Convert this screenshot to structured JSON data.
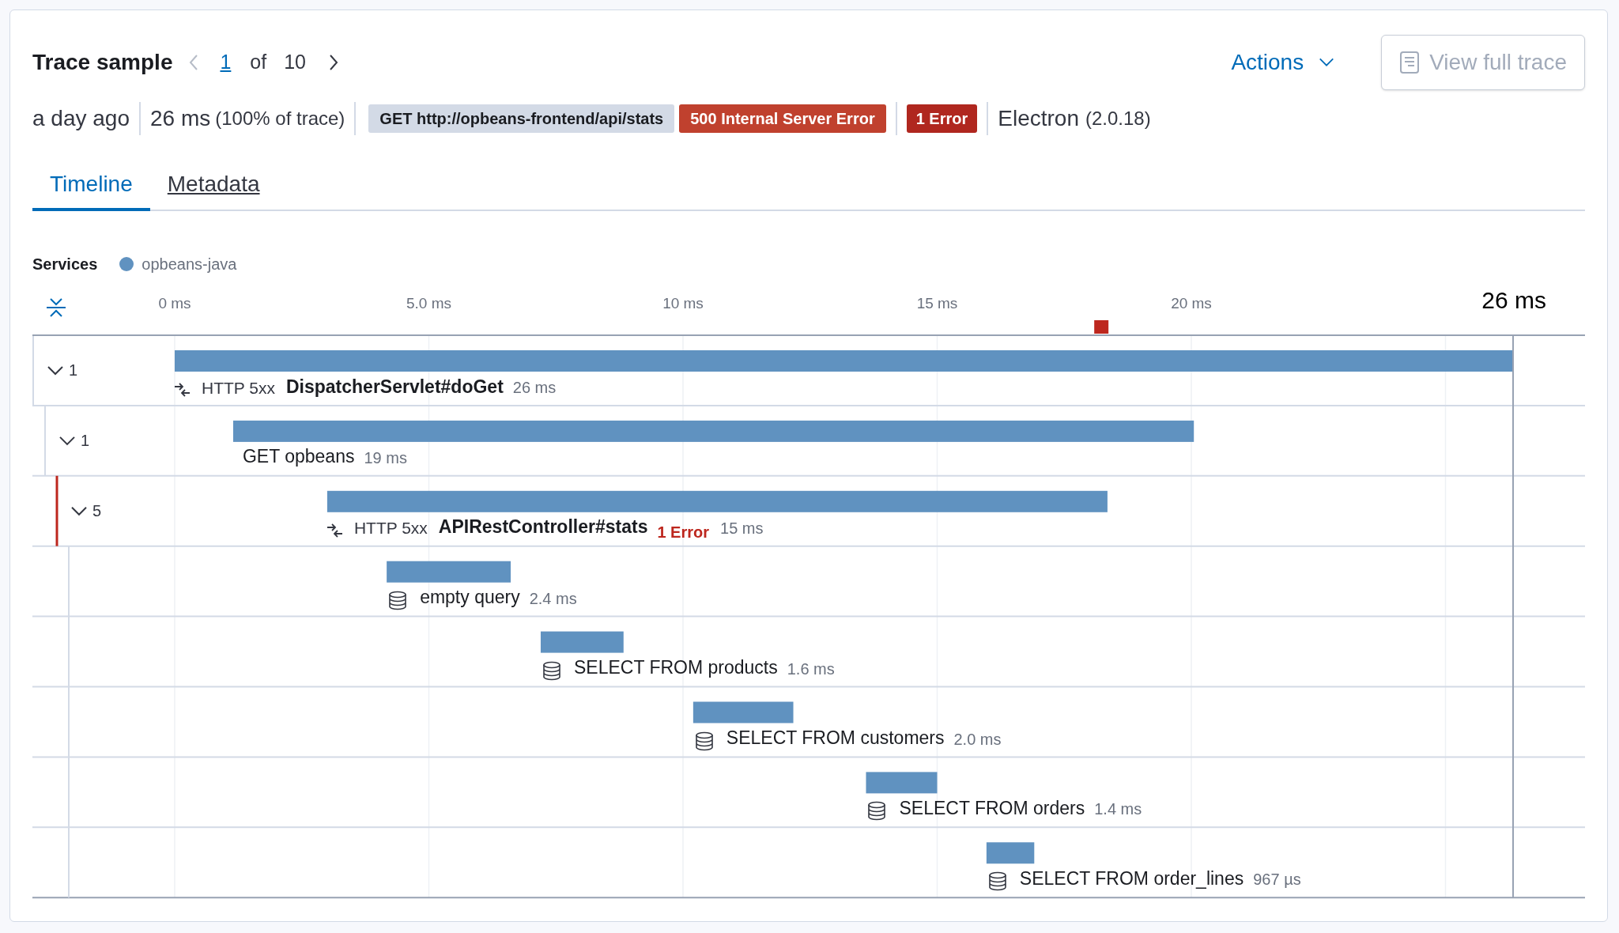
{
  "header": {
    "title": "Trace sample",
    "pager": {
      "prev_disabled": true,
      "current": "1",
      "of": "of",
      "total": "10"
    },
    "actions": "Actions",
    "view_full_trace": {
      "label": "View full trace",
      "disabled": true
    }
  },
  "summary": {
    "age": "a day ago",
    "duration": "26 ms",
    "duration_share": "(100% of trace)",
    "badges": [
      {
        "text": "GET http://opbeans-frontend/api/stats",
        "kind": "neutral"
      },
      {
        "text": "500 Internal Server Error",
        "kind": "danger"
      }
    ],
    "error_badge": "1 Error",
    "agent": "Electron",
    "agent_version": "(2.0.18)"
  },
  "tabs": [
    {
      "label": "Timeline",
      "selected": true
    },
    {
      "label": "Metadata",
      "selected": false
    }
  ],
  "services": {
    "title": "Services",
    "items": [
      {
        "name": "opbeans-java",
        "color": "#6092c0"
      }
    ]
  },
  "timeline": {
    "total": "26 ms",
    "ticks": [
      "0 ms",
      "5.0 ms",
      "10 ms",
      "15 ms",
      "20 ms"
    ],
    "spans": [
      {
        "kind": "transaction",
        "status": "HTTP 5xx",
        "name": "DispatcherServlet#doGet",
        "duration": "26 ms",
        "child_count": "1",
        "expanded": true,
        "children": [
          {
            "kind": "external",
            "name": "GET opbeans",
            "duration": "19 ms",
            "child_count": "1",
            "expanded": true,
            "children": [
              {
                "kind": "transaction",
                "status": "HTTP 5xx",
                "name": "APIRestController#stats",
                "error": "1 Error",
                "duration": "15 ms",
                "child_count": "5",
                "expanded": true,
                "children": [
                  {
                    "kind": "db",
                    "name": "empty query",
                    "duration": "2.4 ms"
                  },
                  {
                    "kind": "db",
                    "name": "SELECT FROM products",
                    "duration": "1.6 ms"
                  },
                  {
                    "kind": "db",
                    "name": "SELECT FROM customers",
                    "duration": "2.0 ms"
                  },
                  {
                    "kind": "db",
                    "name": "SELECT FROM orders",
                    "duration": "1.4 ms"
                  },
                  {
                    "kind": "db",
                    "name": "SELECT FROM order_lines",
                    "duration": "967 µs"
                  }
                ]
              }
            ]
          }
        ]
      }
    ]
  }
}
